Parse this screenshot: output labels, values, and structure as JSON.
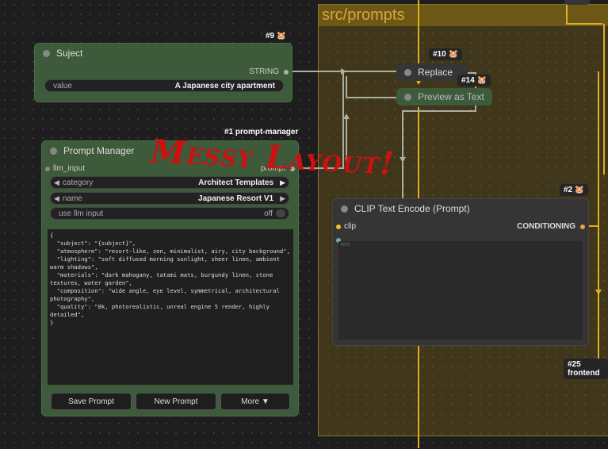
{
  "group": {
    "title": "src/prompts"
  },
  "subject_node": {
    "badge": "#9 🐹",
    "title": "Suject",
    "output": "STRING",
    "widget_label": "value",
    "widget_value": "A Japanese city apartment"
  },
  "replace_node": {
    "badge": "#10 🐹",
    "title": "Replace"
  },
  "preview_node": {
    "badge": "#14 🐹",
    "title": "Preview as Text"
  },
  "prompt_manager": {
    "badge": "#1 prompt-manager",
    "title": "Prompt Manager",
    "input": "llm_input",
    "output": "prompt",
    "category_label": "category",
    "category_value": "Architect Templates",
    "name_label": "name",
    "name_value": "Japanese Resort V1",
    "toggle_label": "use llm input",
    "toggle_value": "off",
    "code": "{\n  \"subject\": \"{subject}\",\n  \"atmosphere\": \"resort-like, zen, minimalist, airy, city background\",\n  \"lighting\": \"soft diffused morning sunlight, sheer linen, ambient warm shadows\",\n  \"materials\": \"dark mahogany, tatami mats, burgundy linen, stone textures, water garden\",\n  \"composition\": \"wide angle, eye level, symmetrical, architectural photography\",\n  \"quality\": \"8k, photorealistic, unreal engine 5 render, highly detailed\",\n}",
    "buttons": [
      "Save Prompt",
      "New Prompt",
      "More ▼"
    ]
  },
  "clip_node": {
    "badge": "#2 🐹",
    "title": "CLIP Text Encode (Prompt)",
    "input": "clip",
    "output": "CONDITIONING",
    "placeholder": "text"
  },
  "frontend_badge": "#25 frontend",
  "overlay_text": "Messy Layout!",
  "colors": {
    "node_green": "#3d5a3a",
    "node_dark": "#353535",
    "wire_yellow": "#e0b020",
    "wire_gray": "#aab0a0",
    "overlay_red": "#cc1111"
  }
}
